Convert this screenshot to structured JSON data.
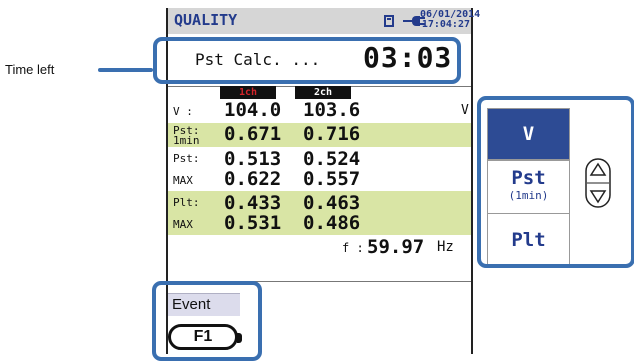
{
  "callout": {
    "label": "Time left"
  },
  "header": {
    "mode": "QUALITY",
    "date": "06/01/2014",
    "time": "17:04:27"
  },
  "calc": {
    "label": "Pst Calc. ...",
    "remaining": "03:03"
  },
  "channels": [
    "1ch",
    "2ch"
  ],
  "rows": {
    "v": {
      "label": "V :",
      "ch1": "104.0",
      "ch2": "103.6",
      "unit": "V"
    },
    "pst1": {
      "label1": "Pst:",
      "label2": "1min",
      "ch1": "0.671",
      "ch2": "0.716"
    },
    "pst": {
      "label": "Pst:",
      "ch1": "0.513",
      "ch2": "0.524"
    },
    "pstmax": {
      "label": "MAX",
      "ch1": "0.622",
      "ch2": "0.557"
    },
    "plt": {
      "label": "Plt:",
      "ch1": "0.433",
      "ch2": "0.463"
    },
    "pltmax": {
      "label": "MAX",
      "ch1": "0.531",
      "ch2": "0.486"
    }
  },
  "frequency": {
    "label": "f :",
    "value": "59.97",
    "unit": "Hz"
  },
  "event": {
    "label": "Event"
  },
  "softkeys": {
    "key1": {
      "label": "V"
    },
    "key2": {
      "label": "Pst",
      "sub": "(1min)"
    },
    "key3": {
      "label": "Plt"
    }
  },
  "function_key": {
    "label": "F1"
  },
  "icons": [
    "sd-card-icon",
    "power-plug-icon",
    "up-arrow-icon",
    "down-arrow-icon"
  ],
  "colors": {
    "title": "#233b8c",
    "highlight": "#3a6fb0",
    "row_green": "#d9e5a5",
    "softkey_active": "#2d4b94",
    "ch1": "#d4242a"
  }
}
